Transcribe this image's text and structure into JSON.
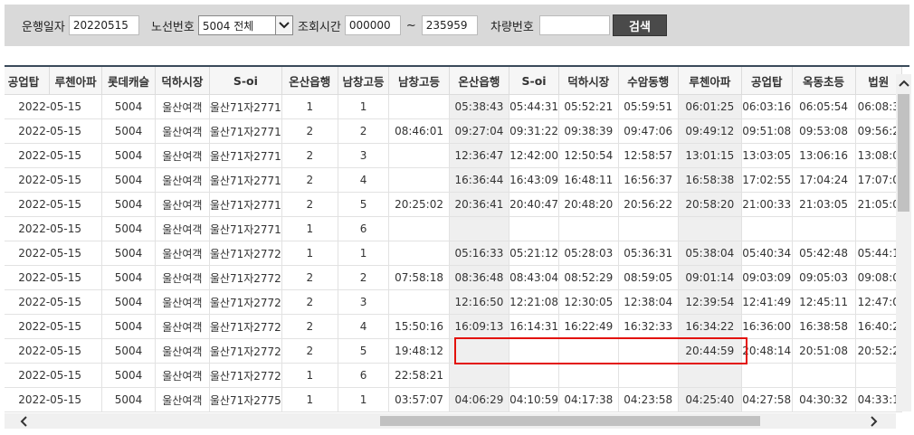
{
  "search": {
    "date_label": "운행일자",
    "date_value": "20220515",
    "route_label": "노선번호",
    "route_value": "5004 전체",
    "time_label": "조회시간",
    "time_from": "000000",
    "time_sep": "~",
    "time_to": "235959",
    "vehicle_label": "차량번호",
    "vehicle_value": "",
    "search_button": "검색"
  },
  "table": {
    "headers": [
      "공업탑",
      "루첸아파",
      "롯데캐슬",
      "덕하시장",
      "S-oi",
      "온산읍행",
      "남창고등",
      "남창고등",
      "온산읍행",
      "S-oi",
      "덕하시장",
      "수암동행",
      "루첸아파",
      "공업탑",
      "옥동초등",
      "법원"
    ],
    "rows": [
      [
        "2022-05-15",
        "5004",
        "울산여객",
        "울산71자2771",
        "1",
        "1",
        "",
        "05:38:43",
        "05:44:31",
        "05:52:21",
        "05:59:51",
        "06:01:25",
        "06:03:16",
        "06:05:54",
        "06:08:3"
      ],
      [
        "2022-05-15",
        "5004",
        "울산여객",
        "울산71자2771",
        "2",
        "2",
        "08:46:01",
        "09:27:04",
        "09:31:22",
        "09:38:39",
        "09:47:06",
        "09:49:12",
        "09:51:08",
        "09:53:08",
        "09:56:2"
      ],
      [
        "2022-05-15",
        "5004",
        "울산여객",
        "울산71자2771",
        "2",
        "3",
        "",
        "12:36:47",
        "12:42:00",
        "12:50:54",
        "12:58:57",
        "13:01:15",
        "13:03:05",
        "13:06:16",
        "13:08:0"
      ],
      [
        "2022-05-15",
        "5004",
        "울산여객",
        "울산71자2771",
        "2",
        "4",
        "",
        "16:36:44",
        "16:43:09",
        "16:48:11",
        "16:56:37",
        "16:58:38",
        "17:02:55",
        "17:04:24",
        "17:07:0"
      ],
      [
        "2022-05-15",
        "5004",
        "울산여객",
        "울산71자2771",
        "2",
        "5",
        "20:25:02",
        "20:36:41",
        "20:40:47",
        "20:48:20",
        "20:56:22",
        "20:58:20",
        "21:00:33",
        "21:03:05",
        "21:05:0"
      ],
      [
        "2022-05-15",
        "5004",
        "울산여객",
        "울산71자2771",
        "1",
        "6",
        "",
        "",
        "",
        "",
        "",
        "",
        "",
        "",
        ""
      ],
      [
        "2022-05-15",
        "5004",
        "울산여객",
        "울산71자2772",
        "1",
        "1",
        "",
        "05:16:33",
        "05:21:12",
        "05:28:03",
        "05:36:31",
        "05:38:04",
        "05:40:34",
        "05:42:48",
        "05:44:1"
      ],
      [
        "2022-05-15",
        "5004",
        "울산여객",
        "울산71자2772",
        "2",
        "2",
        "07:58:18",
        "08:36:48",
        "08:43:04",
        "08:52:29",
        "08:59:05",
        "09:01:14",
        "09:03:09",
        "09:05:03",
        "09:08:0"
      ],
      [
        "2022-05-15",
        "5004",
        "울산여객",
        "울산71자2772",
        "2",
        "3",
        "",
        "12:16:50",
        "12:21:08",
        "12:30:05",
        "12:38:04",
        "12:39:54",
        "12:41:49",
        "12:45:11",
        "12:47:0"
      ],
      [
        "2022-05-15",
        "5004",
        "울산여객",
        "울산71자2772",
        "2",
        "4",
        "15:50:16",
        "16:09:13",
        "16:14:31",
        "16:22:49",
        "16:32:33",
        "16:34:22",
        "16:36:00",
        "16:38:58",
        "16:40:2"
      ],
      [
        "2022-05-15",
        "5004",
        "울산여객",
        "울산71자2772",
        "2",
        "5",
        "19:48:12",
        "",
        "",
        "",
        "",
        "20:44:59",
        "20:48:14",
        "20:51:08",
        "20:52:2"
      ],
      [
        "2022-05-15",
        "5004",
        "울산여객",
        "울산71자2772",
        "1",
        "6",
        "22:58:21",
        "",
        "",
        "",
        "",
        "",
        "",
        "",
        ""
      ],
      [
        "2022-05-15",
        "5004",
        "울산여객",
        "울산71자2775",
        "1",
        "1",
        "03:57:07",
        "04:06:29",
        "04:10:59",
        "04:17:38",
        "04:23:58",
        "04:25:40",
        "04:27:58",
        "04:30:32",
        "04:33:1"
      ]
    ]
  },
  "colors": {
    "highlight": "#e3120b",
    "button": "#4a4a4a",
    "search_bg": "#d9d9d9"
  },
  "icons": {
    "select_arrow": "chevron-down-icon",
    "scroll_up": "chevron-up-icon",
    "scroll_left": "chevron-left-icon",
    "scroll_right": "chevron-right-icon"
  }
}
